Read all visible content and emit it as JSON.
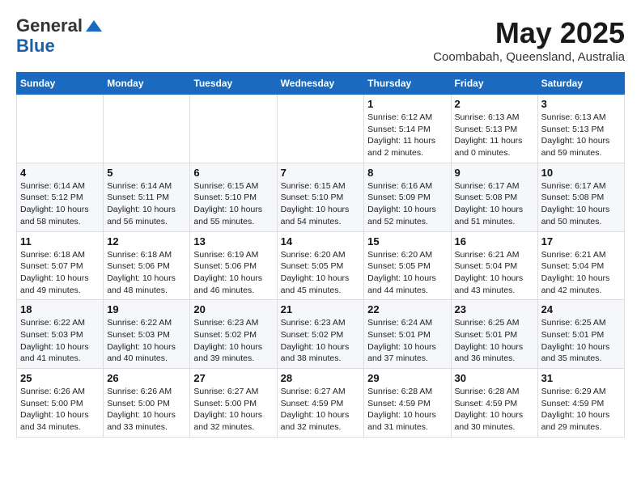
{
  "logo": {
    "general": "General",
    "blue": "Blue"
  },
  "title": "May 2025",
  "subtitle": "Coombabah, Queensland, Australia",
  "days_of_week": [
    "Sunday",
    "Monday",
    "Tuesday",
    "Wednesday",
    "Thursday",
    "Friday",
    "Saturday"
  ],
  "weeks": [
    [
      {
        "day": "",
        "info": ""
      },
      {
        "day": "",
        "info": ""
      },
      {
        "day": "",
        "info": ""
      },
      {
        "day": "",
        "info": ""
      },
      {
        "day": "1",
        "info": "Sunrise: 6:12 AM\nSunset: 5:14 PM\nDaylight: 11 hours\nand 2 minutes."
      },
      {
        "day": "2",
        "info": "Sunrise: 6:13 AM\nSunset: 5:13 PM\nDaylight: 11 hours\nand 0 minutes."
      },
      {
        "day": "3",
        "info": "Sunrise: 6:13 AM\nSunset: 5:13 PM\nDaylight: 10 hours\nand 59 minutes."
      }
    ],
    [
      {
        "day": "4",
        "info": "Sunrise: 6:14 AM\nSunset: 5:12 PM\nDaylight: 10 hours\nand 58 minutes."
      },
      {
        "day": "5",
        "info": "Sunrise: 6:14 AM\nSunset: 5:11 PM\nDaylight: 10 hours\nand 56 minutes."
      },
      {
        "day": "6",
        "info": "Sunrise: 6:15 AM\nSunset: 5:10 PM\nDaylight: 10 hours\nand 55 minutes."
      },
      {
        "day": "7",
        "info": "Sunrise: 6:15 AM\nSunset: 5:10 PM\nDaylight: 10 hours\nand 54 minutes."
      },
      {
        "day": "8",
        "info": "Sunrise: 6:16 AM\nSunset: 5:09 PM\nDaylight: 10 hours\nand 52 minutes."
      },
      {
        "day": "9",
        "info": "Sunrise: 6:17 AM\nSunset: 5:08 PM\nDaylight: 10 hours\nand 51 minutes."
      },
      {
        "day": "10",
        "info": "Sunrise: 6:17 AM\nSunset: 5:08 PM\nDaylight: 10 hours\nand 50 minutes."
      }
    ],
    [
      {
        "day": "11",
        "info": "Sunrise: 6:18 AM\nSunset: 5:07 PM\nDaylight: 10 hours\nand 49 minutes."
      },
      {
        "day": "12",
        "info": "Sunrise: 6:18 AM\nSunset: 5:06 PM\nDaylight: 10 hours\nand 48 minutes."
      },
      {
        "day": "13",
        "info": "Sunrise: 6:19 AM\nSunset: 5:06 PM\nDaylight: 10 hours\nand 46 minutes."
      },
      {
        "day": "14",
        "info": "Sunrise: 6:20 AM\nSunset: 5:05 PM\nDaylight: 10 hours\nand 45 minutes."
      },
      {
        "day": "15",
        "info": "Sunrise: 6:20 AM\nSunset: 5:05 PM\nDaylight: 10 hours\nand 44 minutes."
      },
      {
        "day": "16",
        "info": "Sunrise: 6:21 AM\nSunset: 5:04 PM\nDaylight: 10 hours\nand 43 minutes."
      },
      {
        "day": "17",
        "info": "Sunrise: 6:21 AM\nSunset: 5:04 PM\nDaylight: 10 hours\nand 42 minutes."
      }
    ],
    [
      {
        "day": "18",
        "info": "Sunrise: 6:22 AM\nSunset: 5:03 PM\nDaylight: 10 hours\nand 41 minutes."
      },
      {
        "day": "19",
        "info": "Sunrise: 6:22 AM\nSunset: 5:03 PM\nDaylight: 10 hours\nand 40 minutes."
      },
      {
        "day": "20",
        "info": "Sunrise: 6:23 AM\nSunset: 5:02 PM\nDaylight: 10 hours\nand 39 minutes."
      },
      {
        "day": "21",
        "info": "Sunrise: 6:23 AM\nSunset: 5:02 PM\nDaylight: 10 hours\nand 38 minutes."
      },
      {
        "day": "22",
        "info": "Sunrise: 6:24 AM\nSunset: 5:01 PM\nDaylight: 10 hours\nand 37 minutes."
      },
      {
        "day": "23",
        "info": "Sunrise: 6:25 AM\nSunset: 5:01 PM\nDaylight: 10 hours\nand 36 minutes."
      },
      {
        "day": "24",
        "info": "Sunrise: 6:25 AM\nSunset: 5:01 PM\nDaylight: 10 hours\nand 35 minutes."
      }
    ],
    [
      {
        "day": "25",
        "info": "Sunrise: 6:26 AM\nSunset: 5:00 PM\nDaylight: 10 hours\nand 34 minutes."
      },
      {
        "day": "26",
        "info": "Sunrise: 6:26 AM\nSunset: 5:00 PM\nDaylight: 10 hours\nand 33 minutes."
      },
      {
        "day": "27",
        "info": "Sunrise: 6:27 AM\nSunset: 5:00 PM\nDaylight: 10 hours\nand 32 minutes."
      },
      {
        "day": "28",
        "info": "Sunrise: 6:27 AM\nSunset: 4:59 PM\nDaylight: 10 hours\nand 32 minutes."
      },
      {
        "day": "29",
        "info": "Sunrise: 6:28 AM\nSunset: 4:59 PM\nDaylight: 10 hours\nand 31 minutes."
      },
      {
        "day": "30",
        "info": "Sunrise: 6:28 AM\nSunset: 4:59 PM\nDaylight: 10 hours\nand 30 minutes."
      },
      {
        "day": "31",
        "info": "Sunrise: 6:29 AM\nSunset: 4:59 PM\nDaylight: 10 hours\nand 29 minutes."
      }
    ]
  ]
}
